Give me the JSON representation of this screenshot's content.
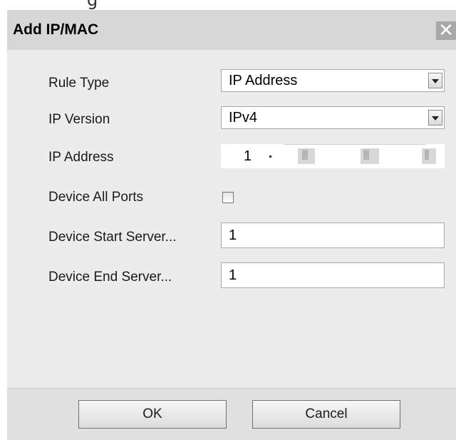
{
  "dialog": {
    "title": "Add IP/MAC",
    "close_icon": "close-icon"
  },
  "form": {
    "rule_type": {
      "label": "Rule Type",
      "value": "IP Address"
    },
    "ip_version": {
      "label": "IP Version",
      "value": "IPv4"
    },
    "ip_address": {
      "label": "IP Address",
      "octet1": "1"
    },
    "device_all_ports": {
      "label": "Device All Ports",
      "checked": false
    },
    "device_start_server": {
      "label": "Device Start Server...",
      "value": "1"
    },
    "device_end_server": {
      "label": "Device End Server...",
      "value": "1"
    }
  },
  "buttons": {
    "ok": "OK",
    "cancel": "Cancel"
  }
}
